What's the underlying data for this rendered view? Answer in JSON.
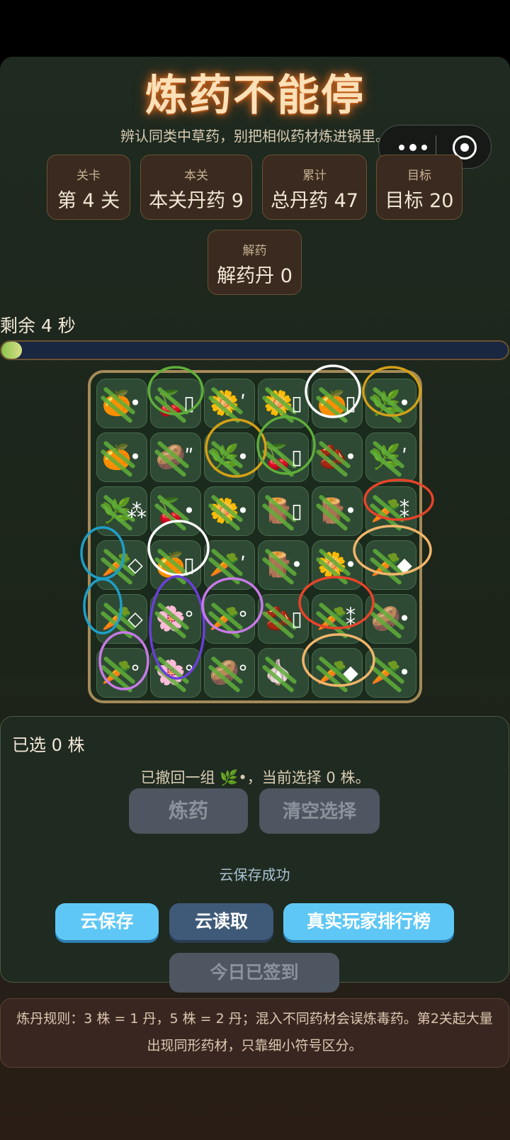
{
  "title": "炼药不能停",
  "subtitle": "辨认同类中草药，别把相似药材炼进锅里。",
  "stats": [
    {
      "label": "关卡",
      "value": "第 4 关"
    },
    {
      "label": "本关",
      "value": "本关丹药 9"
    },
    {
      "label": "累计",
      "value": "总丹药 47"
    },
    {
      "label": "目标",
      "value": "目标 20"
    },
    {
      "label": "解药",
      "value": "解药丹 0"
    }
  ],
  "timer": {
    "text": "剩余 4 秒",
    "progress": 0.04
  },
  "board": {
    "rows": [
      [
        {
          "icon": "🍊",
          "mark": "•"
        },
        {
          "icon": "🍒",
          "mark": "▯"
        },
        {
          "icon": "🌼",
          "mark": "ʹ"
        },
        {
          "icon": "🌼",
          "mark": "▯"
        },
        {
          "icon": "🍊",
          "mark": "▯"
        },
        {
          "icon": "🌿",
          "mark": "•"
        }
      ],
      [
        {
          "icon": "🍊",
          "mark": "•"
        },
        {
          "icon": "🥔",
          "mark": "ʺ"
        },
        {
          "icon": "🌿",
          "mark": "•"
        },
        {
          "icon": "🍒",
          "mark": "▯"
        },
        {
          "icon": "🫘",
          "mark": "•"
        },
        {
          "icon": "🌿",
          "mark": "ʹ"
        }
      ],
      [
        {
          "icon": "🌿",
          "mark": "⁂"
        },
        {
          "icon": "🍒",
          "mark": "•"
        },
        {
          "icon": "🌼",
          "mark": "•"
        },
        {
          "icon": "🪵",
          "mark": "▯"
        },
        {
          "icon": "🪵",
          "mark": "•"
        },
        {
          "icon": "🥕",
          "mark": "⁑"
        }
      ],
      [
        {
          "icon": "🥕",
          "mark": "◇"
        },
        {
          "icon": "🍊",
          "mark": "▯"
        },
        {
          "icon": "🥕",
          "mark": "ʹ"
        },
        {
          "icon": "🪵",
          "mark": "•"
        },
        {
          "icon": "🌼",
          "mark": "•"
        },
        {
          "icon": "🥕",
          "mark": "◆"
        }
      ],
      [
        {
          "icon": "🥕",
          "mark": "◇"
        },
        {
          "icon": "🌸",
          "mark": "°"
        },
        {
          "icon": "🥕",
          "mark": "°"
        },
        {
          "icon": "🫘",
          "mark": "▯"
        },
        {
          "icon": "🥕",
          "mark": "⁑"
        },
        {
          "icon": "🥔",
          "mark": "•"
        }
      ],
      [
        {
          "icon": "🥕",
          "mark": "°"
        },
        {
          "icon": "🌸",
          "mark": "°"
        },
        {
          "icon": "🥔",
          "mark": "°"
        },
        {
          "icon": "🧄",
          "mark": ""
        },
        {
          "icon": "🥕",
          "mark": "◆"
        },
        {
          "icon": "🥕",
          "mark": "•"
        }
      ]
    ],
    "colors": {
      "frame": "#a48a58",
      "tile": "#2e4a34"
    }
  },
  "selection": {
    "text": "已选 0 株",
    "message": "已撤回一组 🌿•，当前选择 0 株。"
  },
  "buttons": {
    "brew": "炼药",
    "clear": "清空选择",
    "cloud_save": "云保存",
    "cloud_load": "云读取",
    "leaderboard": "真实玩家排行榜",
    "checkin": "今日已签到"
  },
  "save_status": "云保存成功",
  "rules": "炼丹规则：3 株 = 1 丹，5 株 = 2 丹；混入不同药材会误炼毒药。第2关起大量出现同形药材，只靠细小符号区分。",
  "colors": {
    "accent_blue": "#5ec7f5",
    "panel": "#1f2a21",
    "title_glow": "#d2691e"
  }
}
